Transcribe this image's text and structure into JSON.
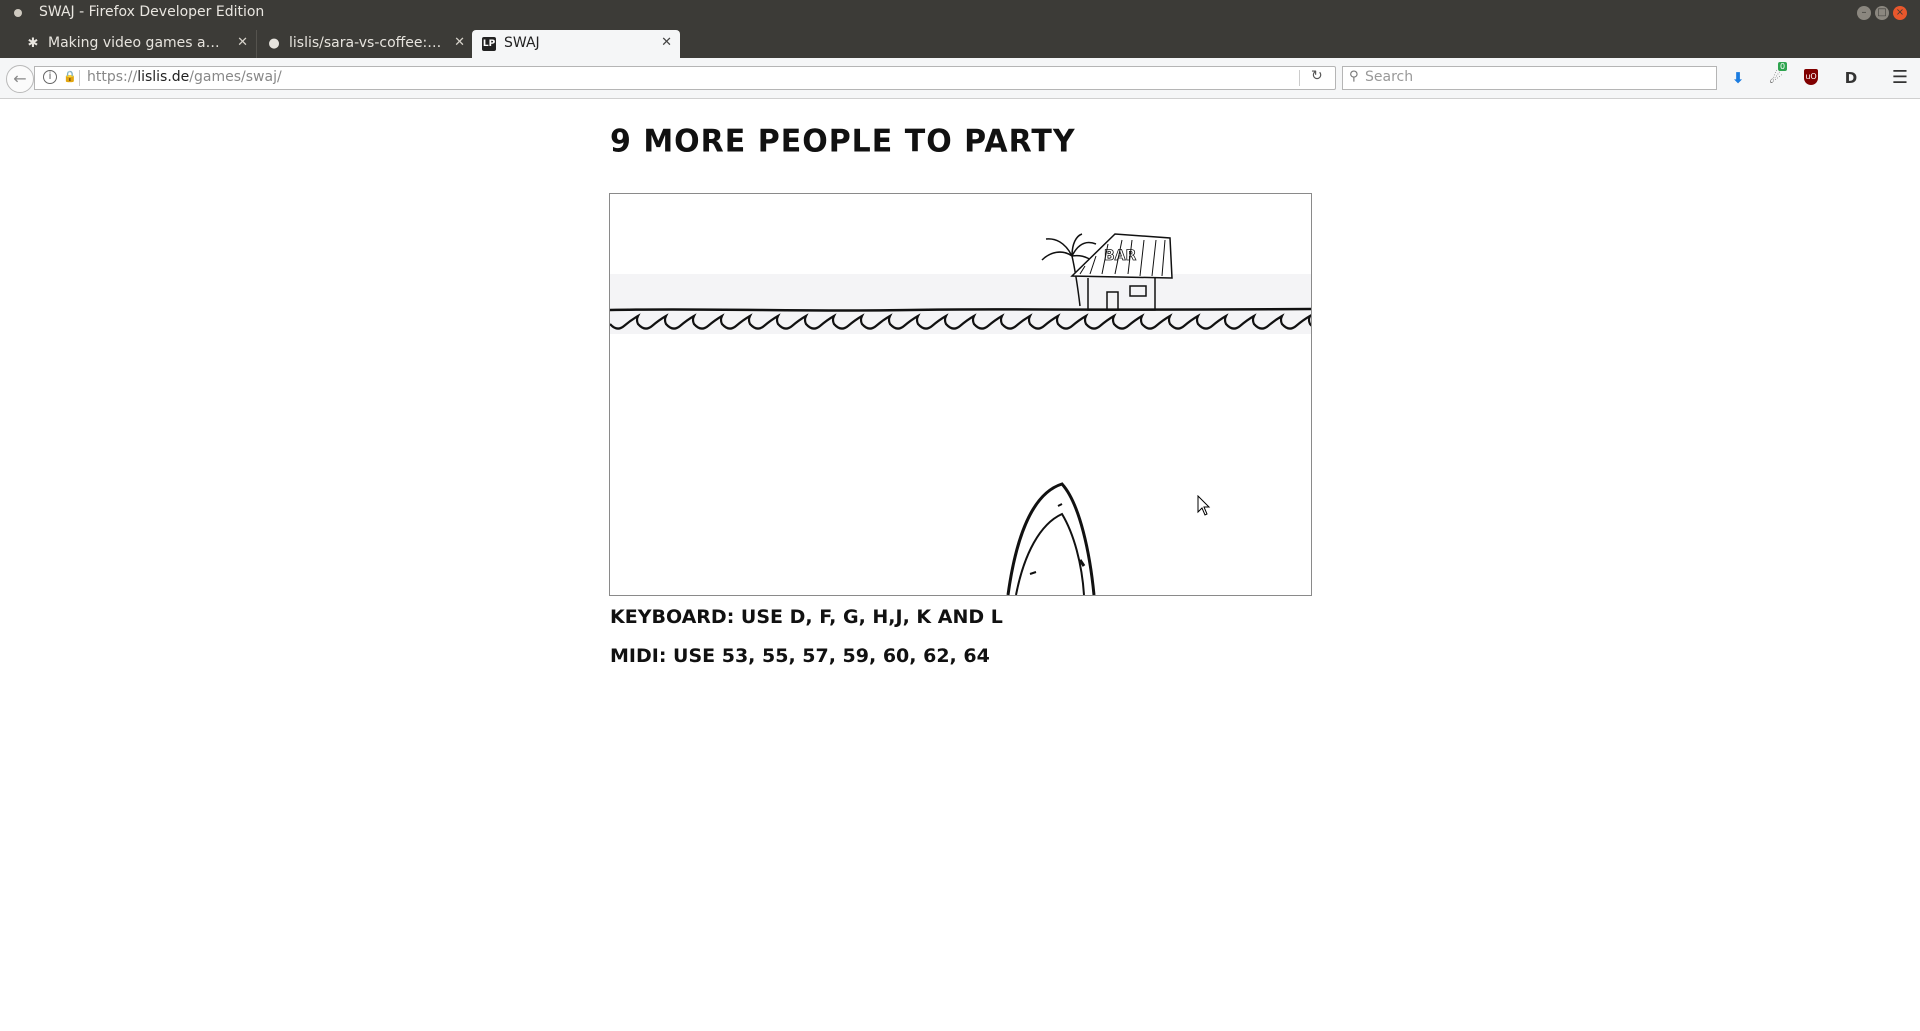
{
  "window": {
    "title": "SWAJ - Firefox Developer Edition"
  },
  "tabs": [
    {
      "label": "Making video games a…",
      "icon": "puzzle-icon"
    },
    {
      "label": "lislis/sara-vs-coffee:…",
      "icon": "github-icon"
    },
    {
      "label": "SWAJ",
      "icon": "lp-favicon",
      "icon_text": "LP",
      "active": true
    }
  ],
  "navbar": {
    "url_prefix": "https://",
    "url_domain": "lislis.de",
    "url_path": "/games/swaj/",
    "search_placeholder": "Search",
    "extension_badge": "0",
    "ublock_label": "uO"
  },
  "page": {
    "heading": "9 MORE PEOPLE TO PARTY",
    "keyboard_info": "KEYBOARD: USE D, F, G, H,J, K AND L",
    "midi_info": "MIDI: USE 53, 55, 57, 59, 60, 62, 64"
  },
  "game": {
    "hut_sign": "BAR"
  }
}
